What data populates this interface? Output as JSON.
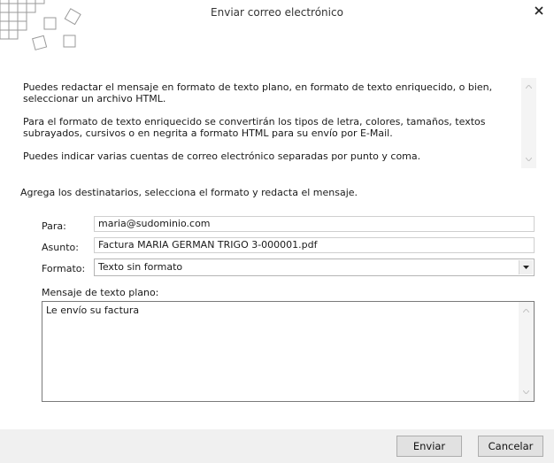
{
  "window": {
    "title": "Enviar correo electrónico"
  },
  "info": {
    "paragraphs": [
      "Puedes redactar el mensaje en formato de texto plano, en formato de texto enriquecido, o bien, seleccionar un archivo HTML.",
      "Para el formato de texto enriquecido se convertirán los tipos de letra, colores, tamaños, textos subrayados, cursivos o en negrita a formato HTML para su envío por E-Mail.",
      "Puedes indicar varias cuentas de correo electrónico separadas por punto y coma."
    ]
  },
  "form": {
    "instructions": "Agrega los destinatarios, selecciona el formato y redacta el mensaje.",
    "to_label": "Para:",
    "to_value": "maria@sudominio.com",
    "subject_label": "Asunto:",
    "subject_value": "Factura MARIA GERMAN TRIGO 3-000001.pdf",
    "format_label": "Formato:",
    "format_value": "Texto sin formato",
    "message_label": "Mensaje de texto plano:",
    "message_value": "Le envío su factura"
  },
  "buttons": {
    "send": "Enviar",
    "cancel": "Cancelar"
  }
}
